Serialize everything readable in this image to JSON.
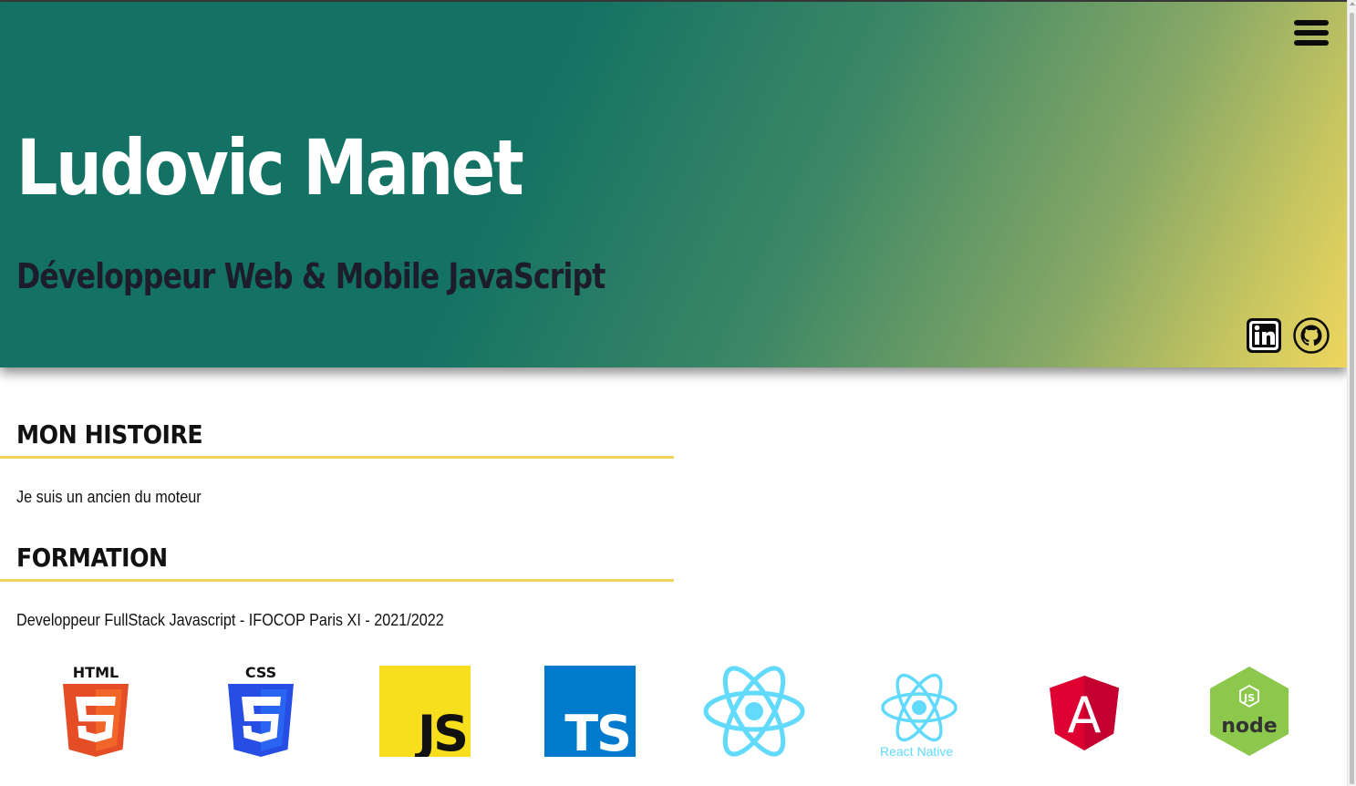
{
  "hero": {
    "name": "Ludovic Manet",
    "title": "Développeur Web & Mobile JavaScript"
  },
  "social": [
    {
      "name": "linkedin",
      "icon": "linkedin-icon"
    },
    {
      "name": "github",
      "icon": "github-icon"
    }
  ],
  "sections": {
    "histoire": {
      "title": "MON HISTOIRE",
      "text": "Je suis un ancien du moteur"
    },
    "formation": {
      "title": "FORMATION",
      "text": "Developpeur FullStack Javascript - IFOCOP Paris XI - 2021/2022"
    }
  },
  "technologies": [
    {
      "name": "HTML",
      "icon": "html5-icon",
      "label": "HTML"
    },
    {
      "name": "CSS",
      "icon": "css3-icon",
      "label": "CSS"
    },
    {
      "name": "JavaScript",
      "icon": "javascript-icon",
      "label": "JS"
    },
    {
      "name": "TypeScript",
      "icon": "typescript-icon",
      "label": "TS"
    },
    {
      "name": "React",
      "icon": "react-icon"
    },
    {
      "name": "React Native",
      "icon": "react-native-icon",
      "label": "React Native"
    },
    {
      "name": "Angular",
      "icon": "angular-icon",
      "label": "A"
    },
    {
      "name": "Node.js",
      "icon": "nodejs-icon",
      "label_top": "JS",
      "label": "node"
    }
  ],
  "colors": {
    "accent": "#f2d45c",
    "hero_start": "#137264",
    "hero_end": "#efd65e",
    "react": "#61dafb"
  }
}
